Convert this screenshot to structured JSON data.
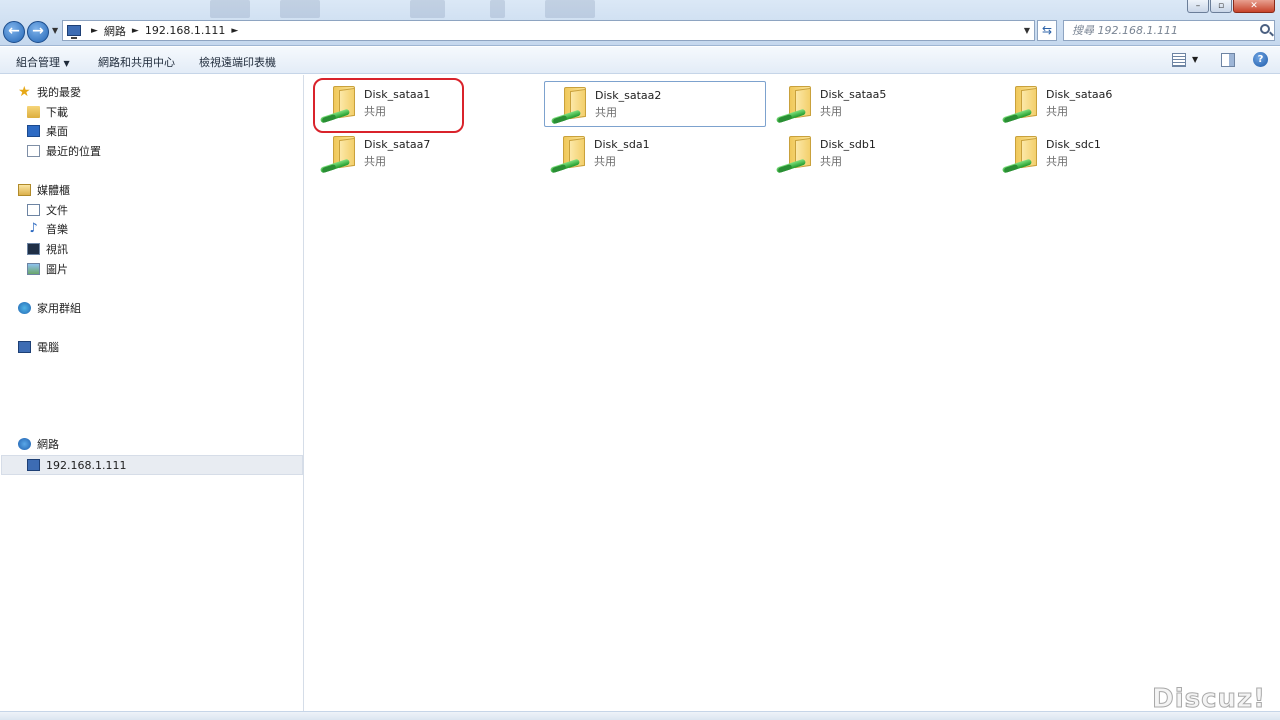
{
  "address_bar": {
    "segments": [
      "網路",
      "192.168.1.111"
    ],
    "search_placeholder": "搜尋 192.168.1.111"
  },
  "toolbar": {
    "organize_label": "組合管理",
    "network_center_label": "網路和共用中心",
    "remote_printers_label": "檢視遠端印表機"
  },
  "nav_pane": {
    "favorites": {
      "label": "我的最愛",
      "items": [
        "下載",
        "桌面",
        "最近的位置"
      ]
    },
    "libraries": {
      "label": "媒體櫃",
      "items": [
        "文件",
        "音樂",
        "視訊",
        "圖片"
      ]
    },
    "homegroup": "家用群組",
    "computer": "電腦",
    "network": {
      "label": "網路",
      "items": [
        "192.168.1.111"
      ]
    }
  },
  "shares": [
    {
      "name": "Disk_sataa1",
      "type": "共用"
    },
    {
      "name": "Disk_sataa2",
      "type": "共用"
    },
    {
      "name": "Disk_sataa5",
      "type": "共用"
    },
    {
      "name": "Disk_sataa6",
      "type": "共用"
    },
    {
      "name": "Disk_sataa7",
      "type": "共用"
    },
    {
      "name": "Disk_sda1",
      "type": "共用"
    },
    {
      "name": "Disk_sdb1",
      "type": "共用"
    },
    {
      "name": "Disk_sdc1",
      "type": "共用"
    }
  ],
  "watermark": "Discuz!",
  "colors": {
    "highlight_ring": "#d9232b",
    "share_pipe": "#1f9a2a",
    "folder": "#f3cf6b"
  }
}
